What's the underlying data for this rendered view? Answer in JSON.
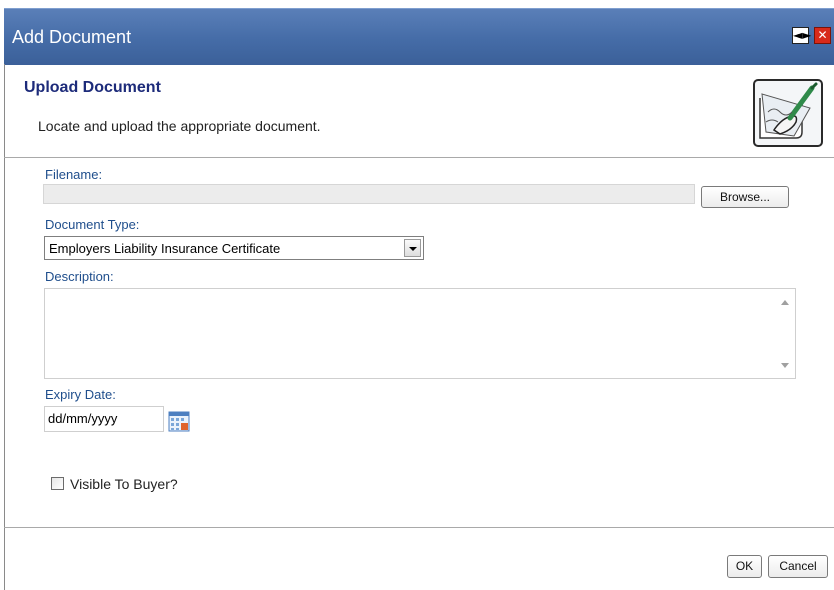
{
  "window": {
    "title": "Add Document"
  },
  "header": {
    "title": "Upload Document",
    "subtitle": "Locate and upload the appropriate document.",
    "icon": "pen-writing-icon"
  },
  "form": {
    "filename": {
      "label": "Filename:",
      "value": "",
      "browse_label": "Browse..."
    },
    "document_type": {
      "label": "Document Type:",
      "selected": "Employers Liability Insurance Certificate"
    },
    "description": {
      "label": "Description:",
      "value": ""
    },
    "expiry_date": {
      "label": "Expiry Date:",
      "value": "dd/mm/yyyy"
    },
    "visible_to_buyer": {
      "label": "Visible To Buyer?",
      "checked": false
    }
  },
  "footer": {
    "ok_label": "OK",
    "cancel_label": "Cancel"
  },
  "colors": {
    "titlebar": "#456ca7",
    "heading": "#1d2b7a",
    "field_label": "#1f4e8c",
    "close": "#d82a1a"
  }
}
